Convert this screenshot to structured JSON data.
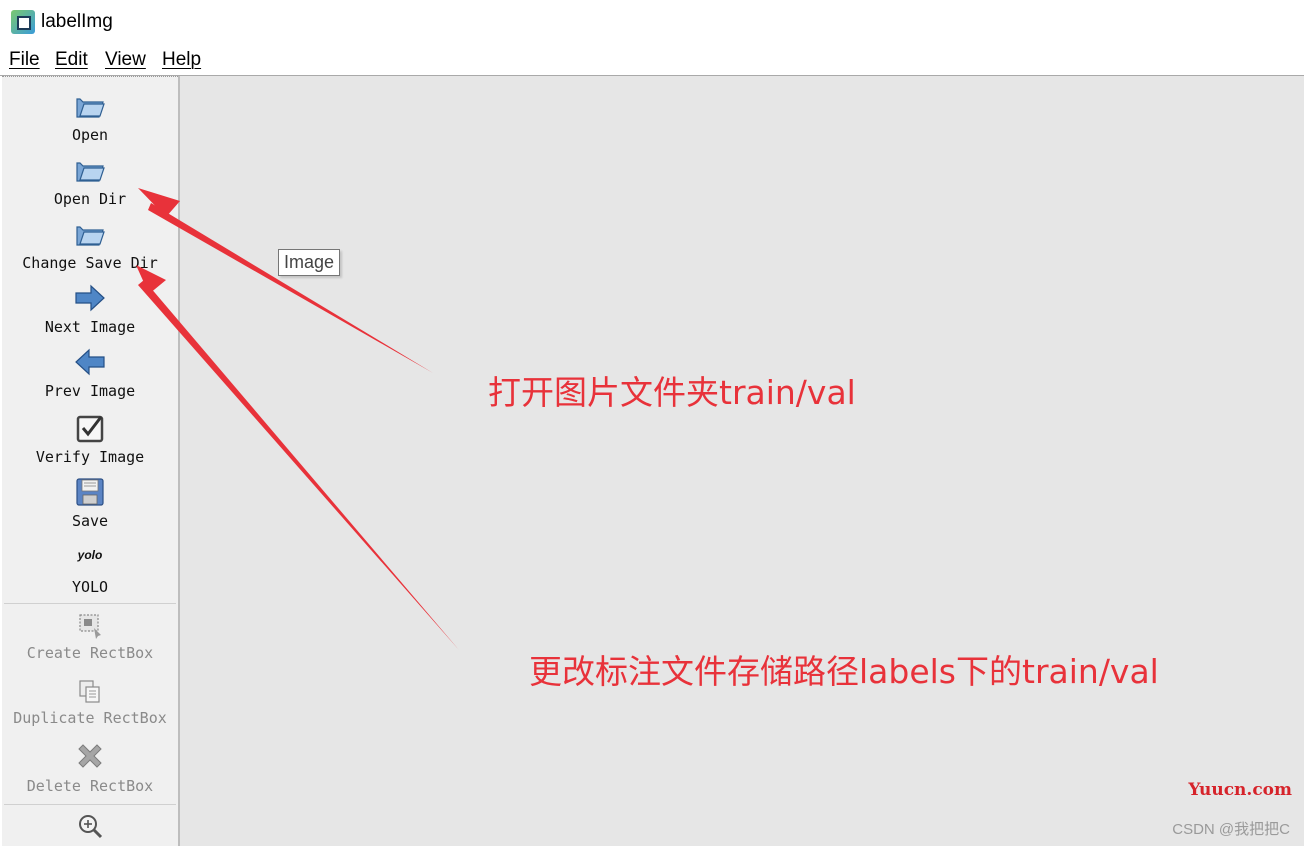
{
  "window": {
    "title": "labelImg"
  },
  "menu": {
    "items": [
      {
        "label": "File"
      },
      {
        "label": "Edit"
      },
      {
        "label": "View"
      },
      {
        "label": "Help"
      }
    ]
  },
  "toolbar": {
    "open": "Open",
    "open_dir": "Open Dir",
    "change_save_dir": "Change Save Dir",
    "next_image": "Next Image",
    "prev_image": "Prev Image",
    "verify_image": "Verify Image",
    "save": "Save",
    "format_icon_text": "yolo",
    "format": "YOLO",
    "create_rectbox": "Create RectBox",
    "duplicate_rectbox": "Duplicate RectBox",
    "delete_rectbox": "Delete RectBox",
    "disabled_color": "#8a8a8a",
    "icons": {
      "open": "folder-open-icon",
      "open_dir": "folder-open-icon",
      "change_save_dir": "folder-open-icon",
      "next_image": "arrow-right-icon",
      "prev_image": "arrow-left-icon",
      "verify_image": "checkbox-icon",
      "save": "floppy-disk-icon",
      "create_rectbox": "rectbox-create-icon",
      "duplicate_rectbox": "copy-icon",
      "delete_rectbox": "x-delete-icon",
      "zoom_in": "zoom-in-icon"
    }
  },
  "canvas": {
    "tooltip": "Image",
    "background": "#e6e6e6"
  },
  "annotations": {
    "color": "#e8323a",
    "text_1": "打开图片文件夹train/val",
    "text_2": "更改标注文件存储路径labels下的train/val"
  },
  "watermarks": {
    "site": "Yuucn.com",
    "author": "CSDN @我把把C"
  }
}
